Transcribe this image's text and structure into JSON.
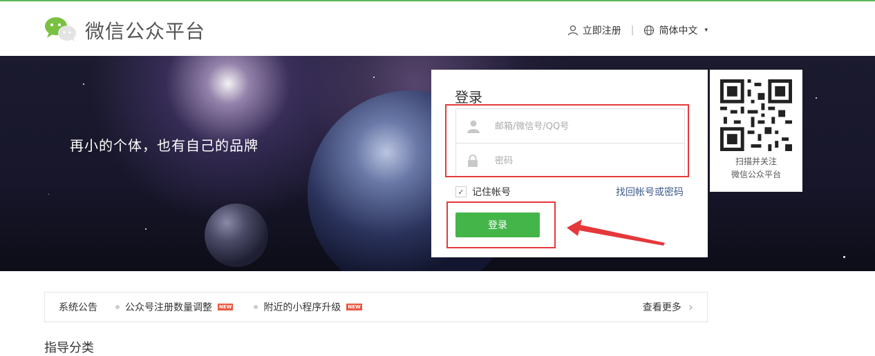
{
  "header": {
    "brand": "微信公众平台",
    "register_label": "立即注册",
    "separator": "|",
    "language_label": "简体中文",
    "caret": "▾"
  },
  "hero": {
    "slogan": "再小的个体，也有自己的品牌"
  },
  "login": {
    "title": "登录",
    "account_placeholder": "邮箱/微信号/QQ号",
    "password_placeholder": "密码",
    "remember_label": "记住帐号",
    "remember_checked": true,
    "check_glyph": "✓",
    "forgot_label": "找回帐号或密码",
    "submit_label": "登录"
  },
  "qr": {
    "caption_line1": "扫描并关注",
    "caption_line2": "微信公众平台"
  },
  "notices": {
    "title": "系统公告",
    "items": [
      {
        "text": "公众号注册数量调整",
        "badge": "NEW"
      },
      {
        "text": "附近的小程序升级",
        "badge": "NEW"
      }
    ],
    "more_label": "查看更多",
    "chevron": "›"
  },
  "bottom": {
    "partial_heading": "指导分类"
  },
  "colors": {
    "accent_green": "#44b549",
    "annotation_red": "#e5383b",
    "link_blue": "#3d5a8c"
  }
}
